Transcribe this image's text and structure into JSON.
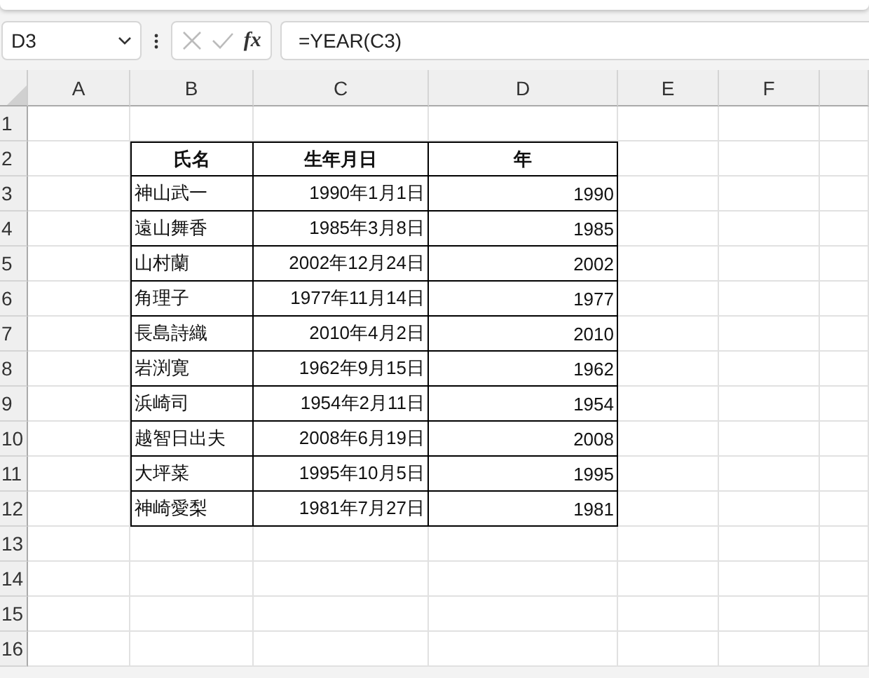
{
  "name_box": {
    "value": "D3"
  },
  "formula_bar": {
    "fx_label": "fx",
    "value": "=YEAR(C3)"
  },
  "columns": [
    "A",
    "B",
    "C",
    "D",
    "E",
    "F"
  ],
  "row_numbers": [
    "1",
    "2",
    "3",
    "4",
    "5",
    "6",
    "7",
    "8",
    "9",
    "10",
    "11",
    "12",
    "13",
    "14",
    "15",
    "16"
  ],
  "table": {
    "headers": [
      "氏名",
      "生年月日",
      "年"
    ],
    "rows": [
      [
        "神山武一",
        "1990年1月1日",
        "1990"
      ],
      [
        "遠山舞香",
        "1985年3月8日",
        "1985"
      ],
      [
        "山村蘭",
        "2002年12月24日",
        "2002"
      ],
      [
        "角理子",
        "1977年11月14日",
        "1977"
      ],
      [
        "長島詩織",
        "2010年4月2日",
        "2010"
      ],
      [
        "岩渕寛",
        "1962年9月15日",
        "1962"
      ],
      [
        "浜崎司",
        "1954年2月11日",
        "1954"
      ],
      [
        "越智日出夫",
        "2008年6月19日",
        "2008"
      ],
      [
        "大坪菜",
        "1995年10月5日",
        "1995"
      ],
      [
        "神崎愛梨",
        "1981年7月27日",
        "1981"
      ]
    ]
  }
}
